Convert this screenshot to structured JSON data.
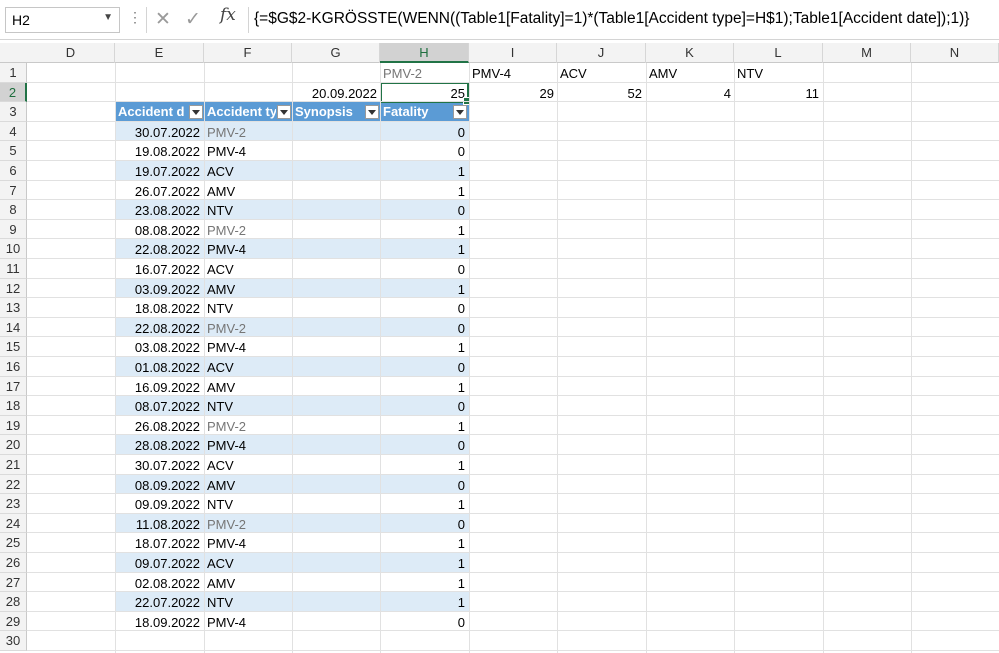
{
  "formula_bar": {
    "name_box": "H2",
    "formula": "{=$G$2-KGRÖSSTE(WENN((Table1[Fatality]=1)*(Table1[Accident type]=H$1);Table1[Accident date]);1)}"
  },
  "column_headers": [
    "D",
    "E",
    "F",
    "G",
    "H",
    "I",
    "J",
    "K",
    "L",
    "M",
    "N"
  ],
  "row_numbers": [
    "1",
    "2",
    "3",
    "4",
    "5",
    "6",
    "7",
    "8",
    "9",
    "10",
    "11",
    "12",
    "13",
    "14",
    "15",
    "16",
    "17",
    "18",
    "19",
    "20",
    "21",
    "22",
    "23",
    "24",
    "25",
    "26",
    "27",
    "28",
    "29",
    "30"
  ],
  "summary": {
    "types": [
      "PMV-2",
      "PMV-4",
      "ACV",
      "AMV",
      "NTV"
    ],
    "values": [
      "25",
      "29",
      "52",
      "4",
      "11"
    ],
    "reference_date": "20.09.2022"
  },
  "table": {
    "headers": [
      "Accident d",
      "Accident ty",
      "Synopsis",
      "Fatality"
    ],
    "rows": [
      {
        "date": "30.07.2022",
        "type": "PMV-2",
        "fatality": "0"
      },
      {
        "date": "19.08.2022",
        "type": "PMV-4",
        "fatality": "0"
      },
      {
        "date": "19.07.2022",
        "type": "ACV",
        "fatality": "1"
      },
      {
        "date": "26.07.2022",
        "type": "AMV",
        "fatality": "1"
      },
      {
        "date": "23.08.2022",
        "type": "NTV",
        "fatality": "0"
      },
      {
        "date": "08.08.2022",
        "type": "PMV-2",
        "fatality": "1"
      },
      {
        "date": "22.08.2022",
        "type": "PMV-4",
        "fatality": "1"
      },
      {
        "date": "16.07.2022",
        "type": "ACV",
        "fatality": "0"
      },
      {
        "date": "03.09.2022",
        "type": "AMV",
        "fatality": "1"
      },
      {
        "date": "18.08.2022",
        "type": "NTV",
        "fatality": "0"
      },
      {
        "date": "22.08.2022",
        "type": "PMV-2",
        "fatality": "0"
      },
      {
        "date": "03.08.2022",
        "type": "PMV-4",
        "fatality": "1"
      },
      {
        "date": "01.08.2022",
        "type": "ACV",
        "fatality": "0"
      },
      {
        "date": "16.09.2022",
        "type": "AMV",
        "fatality": "1"
      },
      {
        "date": "08.07.2022",
        "type": "NTV",
        "fatality": "0"
      },
      {
        "date": "26.08.2022",
        "type": "PMV-2",
        "fatality": "1"
      },
      {
        "date": "28.08.2022",
        "type": "PMV-4",
        "fatality": "0"
      },
      {
        "date": "30.07.2022",
        "type": "ACV",
        "fatality": "1"
      },
      {
        "date": "08.09.2022",
        "type": "AMV",
        "fatality": "0"
      },
      {
        "date": "09.09.2022",
        "type": "NTV",
        "fatality": "1"
      },
      {
        "date": "11.08.2022",
        "type": "PMV-2",
        "fatality": "0"
      },
      {
        "date": "18.07.2022",
        "type": "PMV-4",
        "fatality": "1"
      },
      {
        "date": "09.07.2022",
        "type": "ACV",
        "fatality": "1"
      },
      {
        "date": "02.08.2022",
        "type": "AMV",
        "fatality": "1"
      },
      {
        "date": "22.07.2022",
        "type": "NTV",
        "fatality": "1"
      },
      {
        "date": "18.09.2022",
        "type": "PMV-4",
        "fatality": "0"
      }
    ]
  },
  "colors": {
    "table_header": "#5b9bd5",
    "table_band": "#ddebf7",
    "selection": "#217346"
  }
}
